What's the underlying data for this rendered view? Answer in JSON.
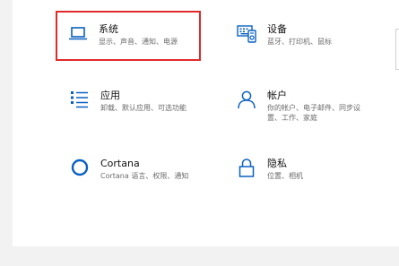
{
  "tiles": [
    {
      "title": "系统",
      "desc": "显示、声音、通知、电源",
      "icon": "laptop-icon"
    },
    {
      "title": "设备",
      "desc": "蓝牙、打印机、鼠标",
      "icon": "keyboard-icon"
    },
    {
      "title": "应用",
      "desc": "卸载、默认应用、可选功能",
      "icon": "list-icon"
    },
    {
      "title": "帐户",
      "desc": "你的帐户、电子邮件、同步设置、工作、家庭",
      "icon": "person-icon"
    },
    {
      "title": "Cortana",
      "desc": "Cortana 语言、权限、通知",
      "icon": "cortana-circle-icon"
    },
    {
      "title": "隐私",
      "desc": "位置、相机",
      "icon": "lock-icon"
    }
  ],
  "colors": {
    "accent": "#0b60c0",
    "highlight": "#e12a2a",
    "panel": "#ffffff",
    "background": "#f2f2f2"
  }
}
